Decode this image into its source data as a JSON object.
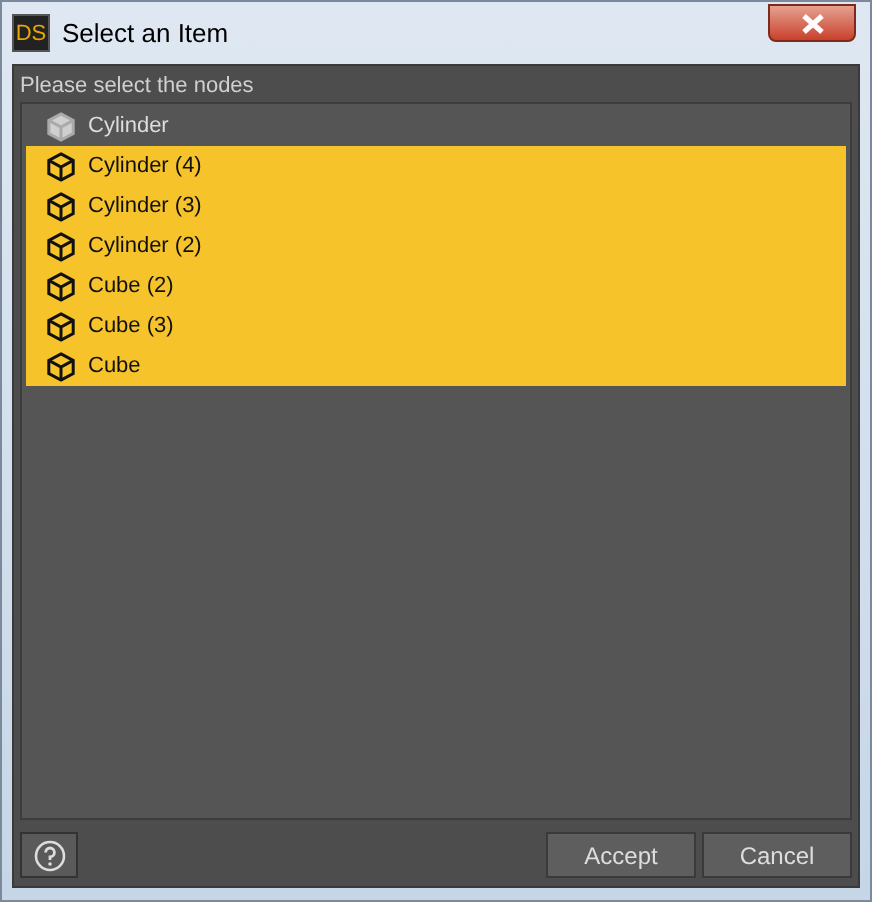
{
  "window": {
    "logo": "DS",
    "title": "Select an Item"
  },
  "prompt": "Please select the nodes",
  "items": [
    {
      "label": "Cylinder",
      "selected": false
    },
    {
      "label": "Cylinder (4)",
      "selected": true
    },
    {
      "label": "Cylinder (3)",
      "selected": true
    },
    {
      "label": "Cylinder (2)",
      "selected": true
    },
    {
      "label": "Cube (2)",
      "selected": true
    },
    {
      "label": "Cube (3)",
      "selected": true
    },
    {
      "label": "Cube",
      "selected": true
    }
  ],
  "buttons": [
    "Accept",
    "Cancel"
  ]
}
